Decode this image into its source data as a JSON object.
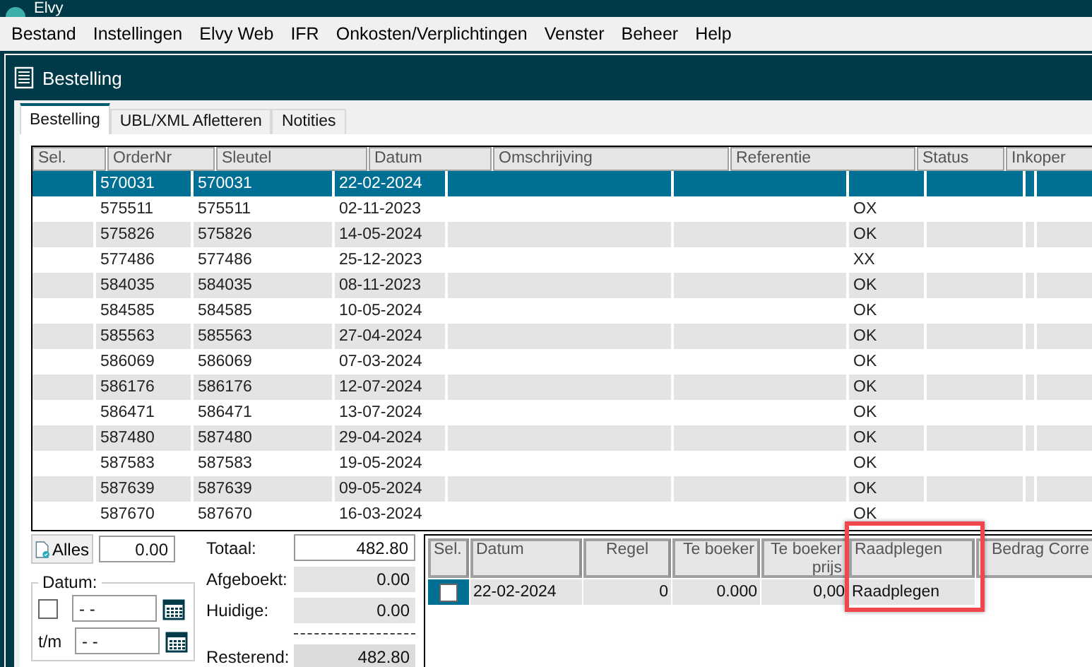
{
  "app": {
    "title": "Elvy"
  },
  "menu": [
    "Bestand",
    "Instellingen",
    "Elvy Web",
    "IFR",
    "Onkosten/Verplichtingen",
    "Venster",
    "Beheer",
    "Help"
  ],
  "window": {
    "title": "Bestelling"
  },
  "tabs": [
    {
      "label": "Bestelling",
      "selected": true
    },
    {
      "label": "UBL/XML Afletteren",
      "selected": false
    },
    {
      "label": "Notities",
      "selected": false
    }
  ],
  "orders": {
    "columns": [
      "Sel.",
      "OrderNr",
      "Sleutel",
      "Datum",
      "Omschrijving",
      "Referentie",
      "Status",
      "Inkoper"
    ],
    "rows": [
      {
        "order": "570031",
        "key": "570031",
        "date": "22-02-2024",
        "status": "",
        "selected": true
      },
      {
        "order": "575511",
        "key": "575511",
        "date": "02-11-2023",
        "status": "OX",
        "selected": false
      },
      {
        "order": "575826",
        "key": "575826",
        "date": "14-05-2024",
        "status": "OK",
        "selected": false
      },
      {
        "order": "577486",
        "key": "577486",
        "date": "25-12-2023",
        "status": "XX",
        "selected": false
      },
      {
        "order": "584035",
        "key": "584035",
        "date": "08-11-2023",
        "status": "OK",
        "selected": false
      },
      {
        "order": "584585",
        "key": "584585",
        "date": "10-05-2024",
        "status": "OK",
        "selected": false
      },
      {
        "order": "585563",
        "key": "585563",
        "date": "27-04-2024",
        "status": "OK",
        "selected": false
      },
      {
        "order": "586069",
        "key": "586069",
        "date": "07-03-2024",
        "status": "OK",
        "selected": false
      },
      {
        "order": "586176",
        "key": "586176",
        "date": "12-07-2024",
        "status": "OK",
        "selected": false
      },
      {
        "order": "586471",
        "key": "586471",
        "date": "13-07-2024",
        "status": "OK",
        "selected": false
      },
      {
        "order": "587480",
        "key": "587480",
        "date": "29-04-2024",
        "status": "OK",
        "selected": false
      },
      {
        "order": "587583",
        "key": "587583",
        "date": "19-05-2024",
        "status": "OK",
        "selected": false
      },
      {
        "order": "587639",
        "key": "587639",
        "date": "09-05-2024",
        "status": "OK",
        "selected": false
      },
      {
        "order": "587670",
        "key": "587670",
        "date": "16-03-2024",
        "status": "OK",
        "selected": false
      }
    ]
  },
  "filter": {
    "all_button": "Alles",
    "all_value": "0.00",
    "date_group": "Datum:",
    "date_checked": false,
    "from_value": "- -",
    "to_label": "t/m",
    "to_value": "- -"
  },
  "totals": [
    {
      "label": "Totaal:",
      "value": "482.80",
      "kind": "field"
    },
    {
      "label": "Afgeboekt:",
      "value": "0.00",
      "kind": "readonly"
    },
    {
      "label": "Huidige:",
      "value": "0.00",
      "kind": "readonly"
    },
    {
      "label": "Resterend:",
      "value": "482.80",
      "kind": "result"
    }
  ],
  "lines": {
    "columns": [
      {
        "label": "Sel.",
        "highlighted": false
      },
      {
        "label": "Datum",
        "highlighted": false
      },
      {
        "label": "Regel",
        "highlighted": false
      },
      {
        "label": "Te boeker",
        "highlighted": false
      },
      {
        "label": "Te boeker prijs",
        "highlighted": false
      },
      {
        "label": "Raadplegen",
        "highlighted": true
      },
      {
        "label": "Bedrag Corre",
        "highlighted": false
      }
    ],
    "rows": [
      {
        "checked": false,
        "date": "22-02-2024",
        "line": "0",
        "amount": "0.000",
        "price": "0,00",
        "action": "Raadplegen"
      }
    ]
  }
}
